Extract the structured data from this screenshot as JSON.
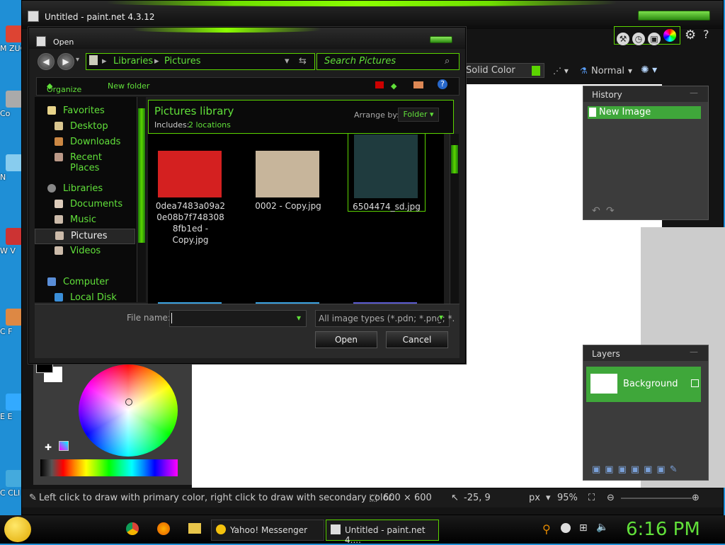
{
  "desktop": {
    "icons": [
      {
        "label": "M ZUC",
        "color": "#d43"
      },
      {
        "label": "Co",
        "color": "#aaa"
      },
      {
        "label": "N",
        "color": "#8ce"
      },
      {
        "label": "W V",
        "color": "#c33"
      },
      {
        "label": "C F",
        "color": "#d84"
      },
      {
        "label": "E E",
        "color": "#3af"
      },
      {
        "label": "C CLI",
        "color": "#4ad"
      }
    ]
  },
  "app": {
    "title": "Untitled - paint.net 4.3.12",
    "toolbar": {
      "fill_mode": "Solid Color",
      "blend_mode": "Normal"
    },
    "history": {
      "title": "History",
      "items": [
        "New Image"
      ]
    },
    "layers": {
      "title": "Layers",
      "items": [
        "Background"
      ]
    },
    "statusbar": {
      "hint": "Left click to draw with primary color, right click to draw with secondary color.",
      "image_size": "600 × 600",
      "cursor_pos": "-25, 9",
      "units": "px",
      "zoom": "95%"
    }
  },
  "dialog": {
    "title": "Open",
    "breadcrumb": [
      "Libraries",
      "Pictures"
    ],
    "search_placeholder": "Search Pictures",
    "commands": {
      "organize": "Organize",
      "new_folder": "New folder"
    },
    "nav": {
      "favorites": "Favorites",
      "favorites_items": [
        "Desktop",
        "Downloads",
        "Recent Places"
      ],
      "libraries": "Libraries",
      "libraries_items": [
        "Documents",
        "Music",
        "Pictures",
        "Videos"
      ],
      "computer": "Computer",
      "computer_items": [
        "Local Disk (C:)"
      ]
    },
    "library": {
      "title": "Pictures library",
      "includes_label": "Includes:",
      "includes_value": "2 locations",
      "arrange_label": "Arrange by:",
      "arrange_value": "Folder"
    },
    "files": [
      {
        "name": "0dea7483a09a2 0e08b7f748308 8fb1ed - Copy.jpg",
        "color": "#d42020"
      },
      {
        "name": "0002 - Copy.jpg",
        "color": "#c7b59b"
      },
      {
        "name": "6504474_sd.jpg",
        "color": "#1f3b3e"
      },
      {
        "name": "",
        "color": "#3aa2e0"
      },
      {
        "name": "",
        "color": "#3aa2e0"
      },
      {
        "name": "",
        "color": "#5a5acf"
      }
    ],
    "filename_label": "File name:",
    "filename_value": "",
    "filetype": "All image types (*.pdn; *.png; *.",
    "open_button": "Open",
    "cancel_button": "Cancel"
  },
  "taskbar": {
    "tasks": [
      "Yahoo! Messenger",
      "Untitled - paint.net 4...."
    ],
    "clock": "6:16 PM"
  }
}
